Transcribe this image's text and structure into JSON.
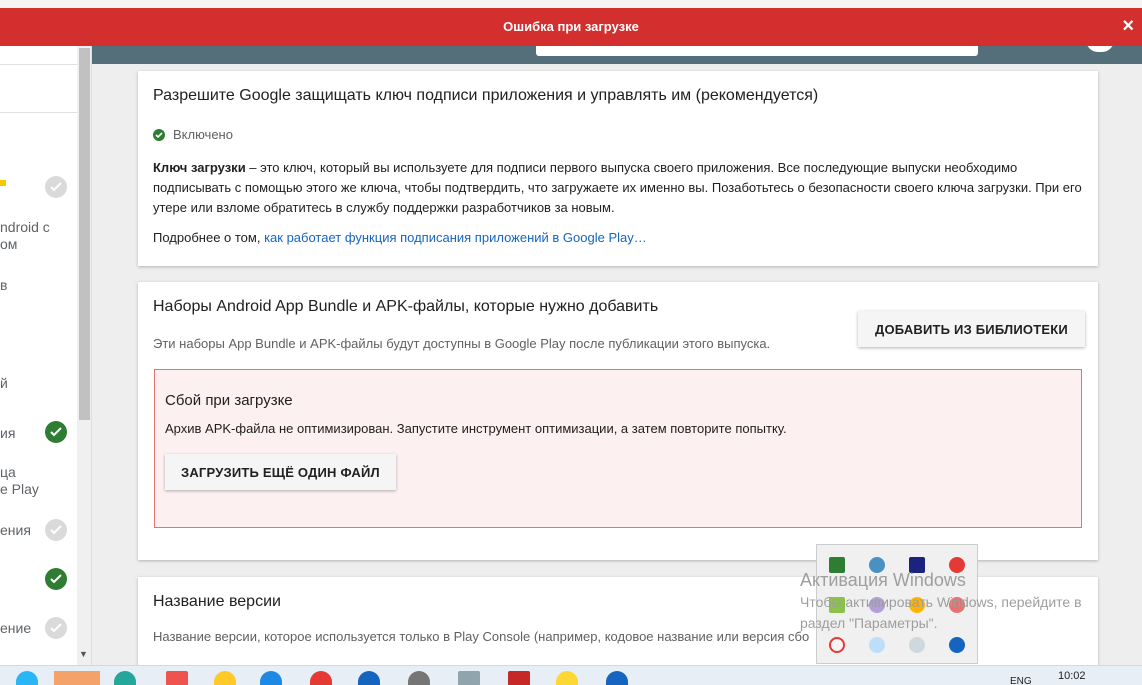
{
  "error_bar": {
    "message": "Ошибка при загрузке",
    "close_label": "×"
  },
  "sidebar": {
    "items": [
      {
        "label": "ndroid с"
      },
      {
        "label": "ом"
      },
      {
        "label": "в"
      },
      {
        "label": "й"
      },
      {
        "label": "ия"
      },
      {
        "label": "ца"
      },
      {
        "label": "e Play"
      },
      {
        "label": "ения"
      },
      {
        "label": "ение"
      }
    ]
  },
  "signing": {
    "title": "Разрешите Google защищать ключ подписи приложения и управлять им (рекомендуется)",
    "status": "Включено",
    "key_term": "Ключ загрузки",
    "description": " – это ключ, который вы используете для подписи первого выпуска своего приложения. Все последующие выпуски необходимо подписывать с помощью этого же ключа, чтобы подтвердить, что загружаете их именно вы. Позаботьтесь о безопасности своего ключа загрузки. При его утере или взломе обратитесь в службу поддержки разработчиков за новым.",
    "more_prefix": "Подробнее о том, ",
    "more_link": "как работает функция подписания приложений в Google Play…"
  },
  "bundles": {
    "title": "Наборы Android App Bundle и APK-файлы, которые нужно добавить",
    "subtitle": "Эти наборы App Bundle и APK-файлы будут доступны в Google Play после публикации этого выпуска.",
    "add_button": "Добавить из библиотеки",
    "error": {
      "title": "Сбой при загрузке",
      "text": "Архив APK-файла не оптимизирован. Запустите инструмент оптимизации, а затем повторите попытку.",
      "upload_button": "Загрузить ещё один файл"
    }
  },
  "version": {
    "title": "Название версии",
    "subtitle": "Название версии, которое используется только в Play Console (например, кодовое название или версия сбо"
  },
  "watermark": {
    "line1": "Активация Windows",
    "line2": "Чтобы активировать Windows, перейдите в",
    "line3": "раздел \"Параметры\"."
  },
  "taskbar": {
    "lang": "ENG",
    "time": "10:02"
  }
}
